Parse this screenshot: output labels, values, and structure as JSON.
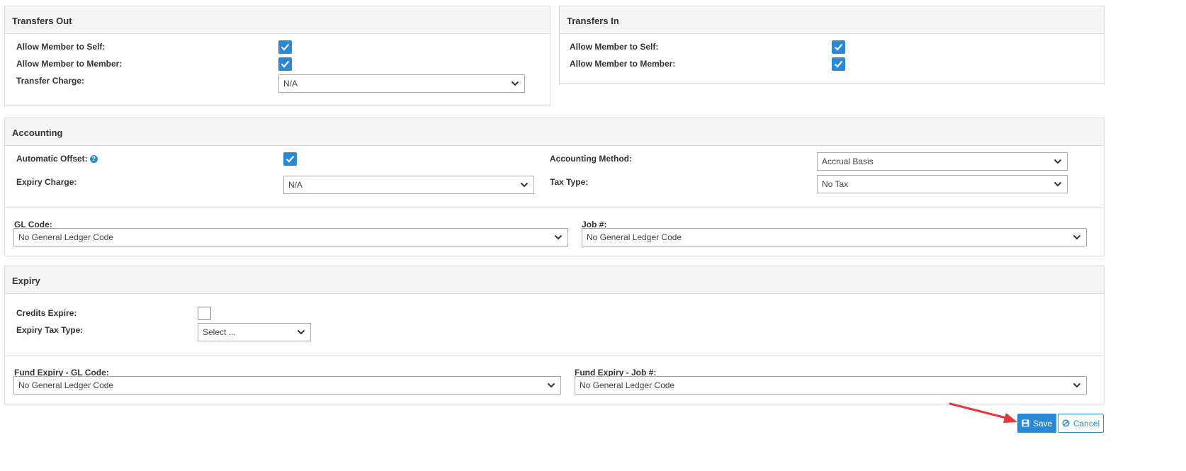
{
  "transfers_out": {
    "title": "Transfers Out",
    "member_to_self_label": "Allow Member to Self:",
    "member_to_self_checked": true,
    "member_to_member_label": "Allow Member to Member:",
    "member_to_member_checked": true,
    "transfer_charge_label": "Transfer Charge:",
    "transfer_charge_value": "N/A"
  },
  "transfers_in": {
    "title": "Transfers In",
    "member_to_self_label": "Allow Member to Self:",
    "member_to_self_checked": true,
    "member_to_member_label": "Allow Member to Member:",
    "member_to_member_checked": true
  },
  "accounting": {
    "title": "Accounting",
    "automatic_offset_label": "Automatic Offset:",
    "automatic_offset_checked": true,
    "help_glyph": "?",
    "expiry_charge_label": "Expiry Charge:",
    "expiry_charge_value": "N/A",
    "accounting_method_label": "Accounting Method:",
    "accounting_method_value": "Accrual Basis",
    "tax_type_label": "Tax Type:",
    "tax_type_value": "No Tax",
    "gl_code_label": "GL Code:",
    "gl_code_value": "No General Ledger Code",
    "job_label": "Job #:",
    "job_value": "No General Ledger Code"
  },
  "expiry": {
    "title": "Expiry",
    "credits_expire_label": "Credits Expire:",
    "credits_expire_checked": false,
    "expiry_tax_type_label": "Expiry Tax Type:",
    "expiry_tax_type_value": "Select ...",
    "fund_gl_code_label": "Fund Expiry - GL Code:",
    "fund_gl_code_value": "No General Ledger Code",
    "fund_job_label": "Fund Expiry - Job #:",
    "fund_job_value": "No General Ledger Code"
  },
  "actions": {
    "save_label": "Save",
    "cancel_label": "Cancel"
  },
  "colors": {
    "accent": "#2a88d4",
    "panel_header": "#f5f5f5",
    "border": "#dcdcdc",
    "annotation_arrow": "#e0383e"
  }
}
